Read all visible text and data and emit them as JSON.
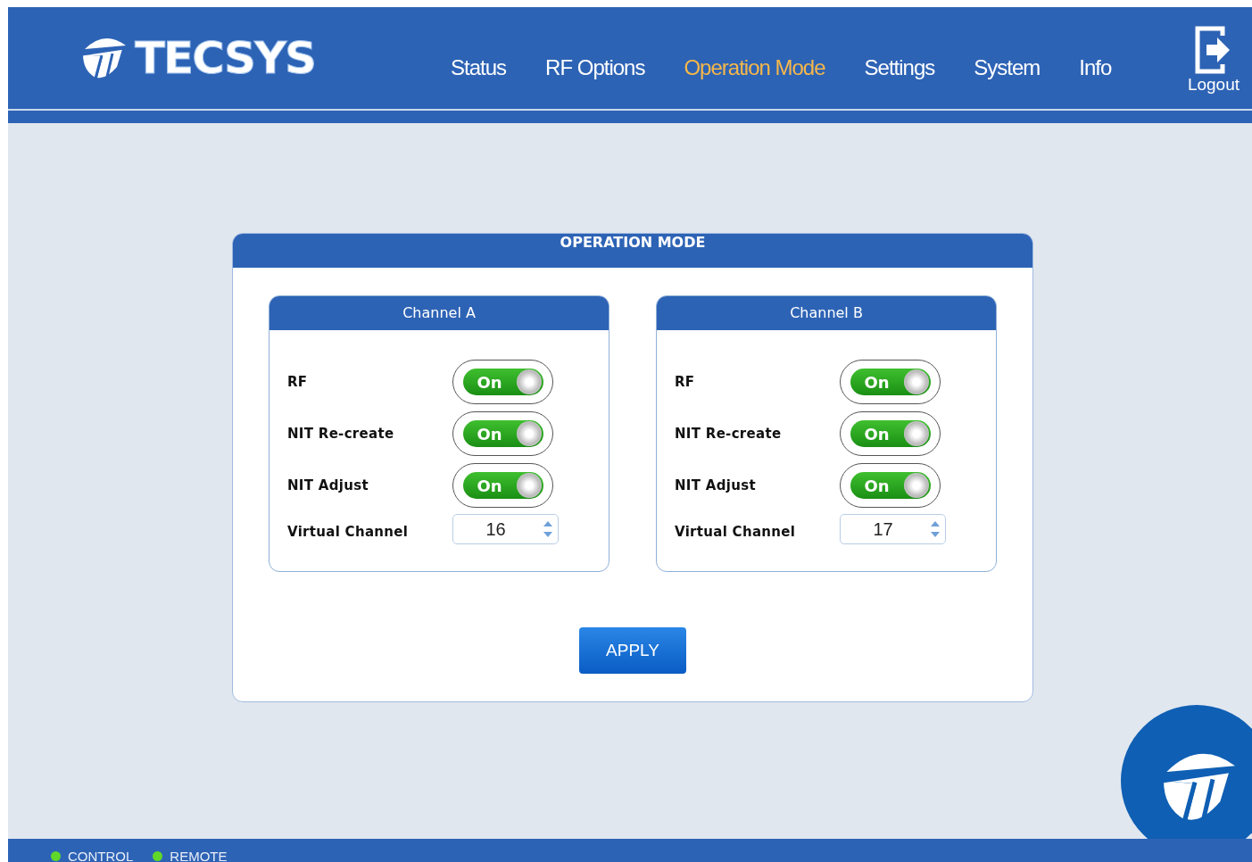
{
  "header": {
    "logo": "TECSYS",
    "nav": [
      {
        "label": "Status",
        "selected": false
      },
      {
        "label": "RF Options",
        "selected": false
      },
      {
        "label": "Operation Mode",
        "selected": true
      },
      {
        "label": "Settings",
        "selected": false
      },
      {
        "label": "System",
        "selected": false
      },
      {
        "label": "Info",
        "selected": false
      }
    ],
    "logout": "Logout"
  },
  "panel": {
    "title": "OPERATION MODE",
    "channels": [
      {
        "title": "Channel A",
        "toggles": [
          {
            "label": "RF",
            "on": true,
            "text": "On"
          },
          {
            "label": "NIT Re-create",
            "on": true,
            "text": "On"
          },
          {
            "label": "NIT Adjust",
            "on": true,
            "text": "On"
          }
        ],
        "virtual_channel": {
          "label": "Virtual Channel",
          "value": "16"
        }
      },
      {
        "title": "Channel B",
        "toggles": [
          {
            "label": "RF",
            "on": true,
            "text": "On"
          },
          {
            "label": "NIT Re-create",
            "on": true,
            "text": "On"
          },
          {
            "label": "NIT Adjust",
            "on": true,
            "text": "On"
          }
        ],
        "virtual_channel": {
          "label": "Virtual Channel",
          "value": "17"
        }
      }
    ],
    "apply": "APPLY"
  },
  "status_bar": [
    {
      "label": "CONTROL",
      "on": true
    },
    {
      "label": "REMOTE",
      "on": true
    }
  ]
}
